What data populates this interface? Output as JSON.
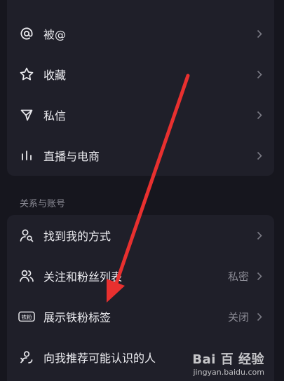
{
  "menu_top": {
    "items": [
      {
        "icon": "at-icon",
        "label": "被@"
      },
      {
        "icon": "star-icon",
        "label": "收藏"
      },
      {
        "icon": "send-icon",
        "label": "私信"
      },
      {
        "icon": "bars-icon",
        "label": "直播与电商"
      }
    ]
  },
  "section": {
    "title": "关系与账号"
  },
  "menu_bottom": {
    "items": [
      {
        "icon": "person-search-icon",
        "label": "找到我的方式",
        "value": ""
      },
      {
        "icon": "people-icon",
        "label": "关注和粉丝列表",
        "value": "私密"
      },
      {
        "icon": "fan-badge-icon",
        "label": "展示铁粉标签",
        "value": "关闭",
        "badge_text": "铁粉"
      },
      {
        "icon": "recommend-icon",
        "label": "向我推荐可能认识的人",
        "value": ""
      }
    ]
  },
  "annotation": {
    "color": "#e8302f"
  },
  "watermark": {
    "logo": "Bai 百 经验",
    "url": "jingyan.baidu.com"
  }
}
